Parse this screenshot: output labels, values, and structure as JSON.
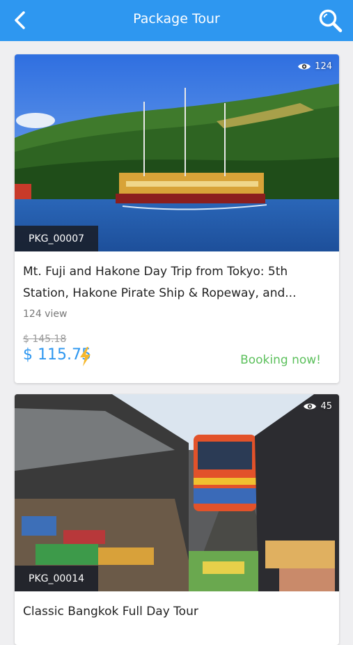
{
  "appbar": {
    "title": "Package Tour",
    "back_icon": "chevron-left-icon",
    "search_icon": "search-icon",
    "color": "#2e97f0"
  },
  "tours": [
    {
      "views_count": "124",
      "code": "PKG_00007",
      "name": "Mt. Fuji and Hakone Day Trip from Tokyo: 5th Station, Hakone Pirate Ship & Ropeway, and...",
      "view_text": "124 view",
      "old_price": "$ 145.18",
      "new_price": "$ 115.75",
      "booking_label": "Booking now!",
      "image": "Pirate ship on Lake Ashi with forested hills"
    },
    {
      "views_count": "45",
      "code": "PKG_00014",
      "name": "Classic Bangkok Full Day Tour",
      "image": "Train passing through railway market in Bangkok"
    }
  ],
  "colors": {
    "accent": "#2e97f0",
    "booking": "#5cc05c",
    "bolt": "#f5b82e"
  }
}
